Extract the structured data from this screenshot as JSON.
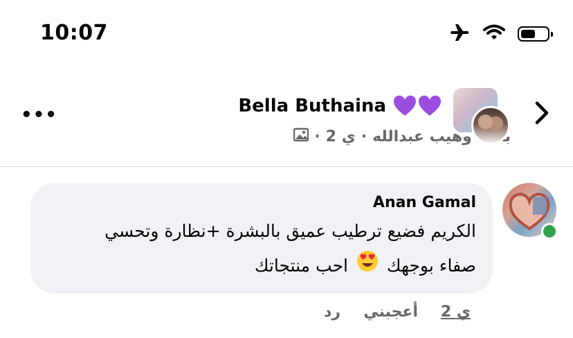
{
  "status_bar": {
    "time": "10:07",
    "icons": [
      "airplane-icon",
      "wifi-icon",
      "battery-icon"
    ],
    "battery_level": 0.55
  },
  "header": {
    "page_name": "Bella Buthaina",
    "name_emoji": "💜💜",
    "subtitle_author": "بثينة وهيب عبدالله",
    "subtitle_time": "2 ي",
    "separator": "·",
    "more_label": "•••"
  },
  "comment": {
    "author": "Anan Gamal",
    "line1": "الكريم فضيع ترطيب عميق بالبشرة +نظارة وتحسي",
    "line2_pre": "صفاء بوجهك",
    "line2_post": "احب منتجاتك",
    "online": true,
    "actions": {
      "time": "2 ي",
      "like": "أعجبني",
      "reply": "رد"
    }
  },
  "colors": {
    "bubble": "#f0f2f5",
    "secondary_text": "#65676b",
    "online": "#31a24c",
    "heart": "#9b4de0"
  }
}
